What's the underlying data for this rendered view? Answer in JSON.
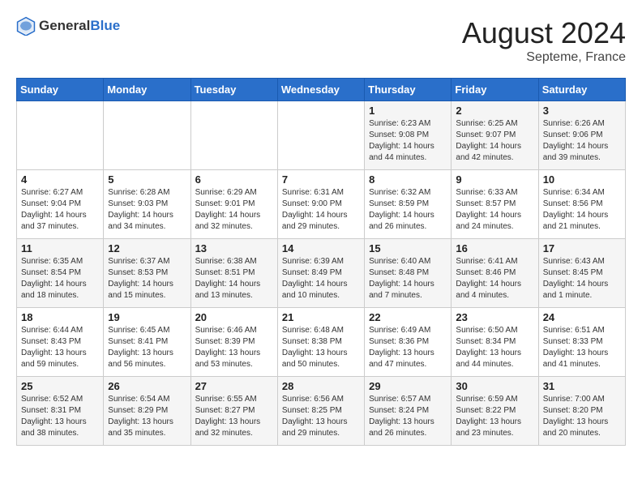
{
  "header": {
    "logo_general": "General",
    "logo_blue": "Blue",
    "month_year": "August 2024",
    "location": "Septeme, France"
  },
  "weekdays": [
    "Sunday",
    "Monday",
    "Tuesday",
    "Wednesday",
    "Thursday",
    "Friday",
    "Saturday"
  ],
  "weeks": [
    [
      {
        "day": "",
        "info": ""
      },
      {
        "day": "",
        "info": ""
      },
      {
        "day": "",
        "info": ""
      },
      {
        "day": "",
        "info": ""
      },
      {
        "day": "1",
        "info": "Sunrise: 6:23 AM\nSunset: 9:08 PM\nDaylight: 14 hours and 44 minutes."
      },
      {
        "day": "2",
        "info": "Sunrise: 6:25 AM\nSunset: 9:07 PM\nDaylight: 14 hours and 42 minutes."
      },
      {
        "day": "3",
        "info": "Sunrise: 6:26 AM\nSunset: 9:06 PM\nDaylight: 14 hours and 39 minutes."
      }
    ],
    [
      {
        "day": "4",
        "info": "Sunrise: 6:27 AM\nSunset: 9:04 PM\nDaylight: 14 hours and 37 minutes."
      },
      {
        "day": "5",
        "info": "Sunrise: 6:28 AM\nSunset: 9:03 PM\nDaylight: 14 hours and 34 minutes."
      },
      {
        "day": "6",
        "info": "Sunrise: 6:29 AM\nSunset: 9:01 PM\nDaylight: 14 hours and 32 minutes."
      },
      {
        "day": "7",
        "info": "Sunrise: 6:31 AM\nSunset: 9:00 PM\nDaylight: 14 hours and 29 minutes."
      },
      {
        "day": "8",
        "info": "Sunrise: 6:32 AM\nSunset: 8:59 PM\nDaylight: 14 hours and 26 minutes."
      },
      {
        "day": "9",
        "info": "Sunrise: 6:33 AM\nSunset: 8:57 PM\nDaylight: 14 hours and 24 minutes."
      },
      {
        "day": "10",
        "info": "Sunrise: 6:34 AM\nSunset: 8:56 PM\nDaylight: 14 hours and 21 minutes."
      }
    ],
    [
      {
        "day": "11",
        "info": "Sunrise: 6:35 AM\nSunset: 8:54 PM\nDaylight: 14 hours and 18 minutes."
      },
      {
        "day": "12",
        "info": "Sunrise: 6:37 AM\nSunset: 8:53 PM\nDaylight: 14 hours and 15 minutes."
      },
      {
        "day": "13",
        "info": "Sunrise: 6:38 AM\nSunset: 8:51 PM\nDaylight: 14 hours and 13 minutes."
      },
      {
        "day": "14",
        "info": "Sunrise: 6:39 AM\nSunset: 8:49 PM\nDaylight: 14 hours and 10 minutes."
      },
      {
        "day": "15",
        "info": "Sunrise: 6:40 AM\nSunset: 8:48 PM\nDaylight: 14 hours and 7 minutes."
      },
      {
        "day": "16",
        "info": "Sunrise: 6:41 AM\nSunset: 8:46 PM\nDaylight: 14 hours and 4 minutes."
      },
      {
        "day": "17",
        "info": "Sunrise: 6:43 AM\nSunset: 8:45 PM\nDaylight: 14 hours and 1 minute."
      }
    ],
    [
      {
        "day": "18",
        "info": "Sunrise: 6:44 AM\nSunset: 8:43 PM\nDaylight: 13 hours and 59 minutes."
      },
      {
        "day": "19",
        "info": "Sunrise: 6:45 AM\nSunset: 8:41 PM\nDaylight: 13 hours and 56 minutes."
      },
      {
        "day": "20",
        "info": "Sunrise: 6:46 AM\nSunset: 8:39 PM\nDaylight: 13 hours and 53 minutes."
      },
      {
        "day": "21",
        "info": "Sunrise: 6:48 AM\nSunset: 8:38 PM\nDaylight: 13 hours and 50 minutes."
      },
      {
        "day": "22",
        "info": "Sunrise: 6:49 AM\nSunset: 8:36 PM\nDaylight: 13 hours and 47 minutes."
      },
      {
        "day": "23",
        "info": "Sunrise: 6:50 AM\nSunset: 8:34 PM\nDaylight: 13 hours and 44 minutes."
      },
      {
        "day": "24",
        "info": "Sunrise: 6:51 AM\nSunset: 8:33 PM\nDaylight: 13 hours and 41 minutes."
      }
    ],
    [
      {
        "day": "25",
        "info": "Sunrise: 6:52 AM\nSunset: 8:31 PM\nDaylight: 13 hours and 38 minutes."
      },
      {
        "day": "26",
        "info": "Sunrise: 6:54 AM\nSunset: 8:29 PM\nDaylight: 13 hours and 35 minutes."
      },
      {
        "day": "27",
        "info": "Sunrise: 6:55 AM\nSunset: 8:27 PM\nDaylight: 13 hours and 32 minutes."
      },
      {
        "day": "28",
        "info": "Sunrise: 6:56 AM\nSunset: 8:25 PM\nDaylight: 13 hours and 29 minutes."
      },
      {
        "day": "29",
        "info": "Sunrise: 6:57 AM\nSunset: 8:24 PM\nDaylight: 13 hours and 26 minutes."
      },
      {
        "day": "30",
        "info": "Sunrise: 6:59 AM\nSunset: 8:22 PM\nDaylight: 13 hours and 23 minutes."
      },
      {
        "day": "31",
        "info": "Sunrise: 7:00 AM\nSunset: 8:20 PM\nDaylight: 13 hours and 20 minutes."
      }
    ]
  ]
}
